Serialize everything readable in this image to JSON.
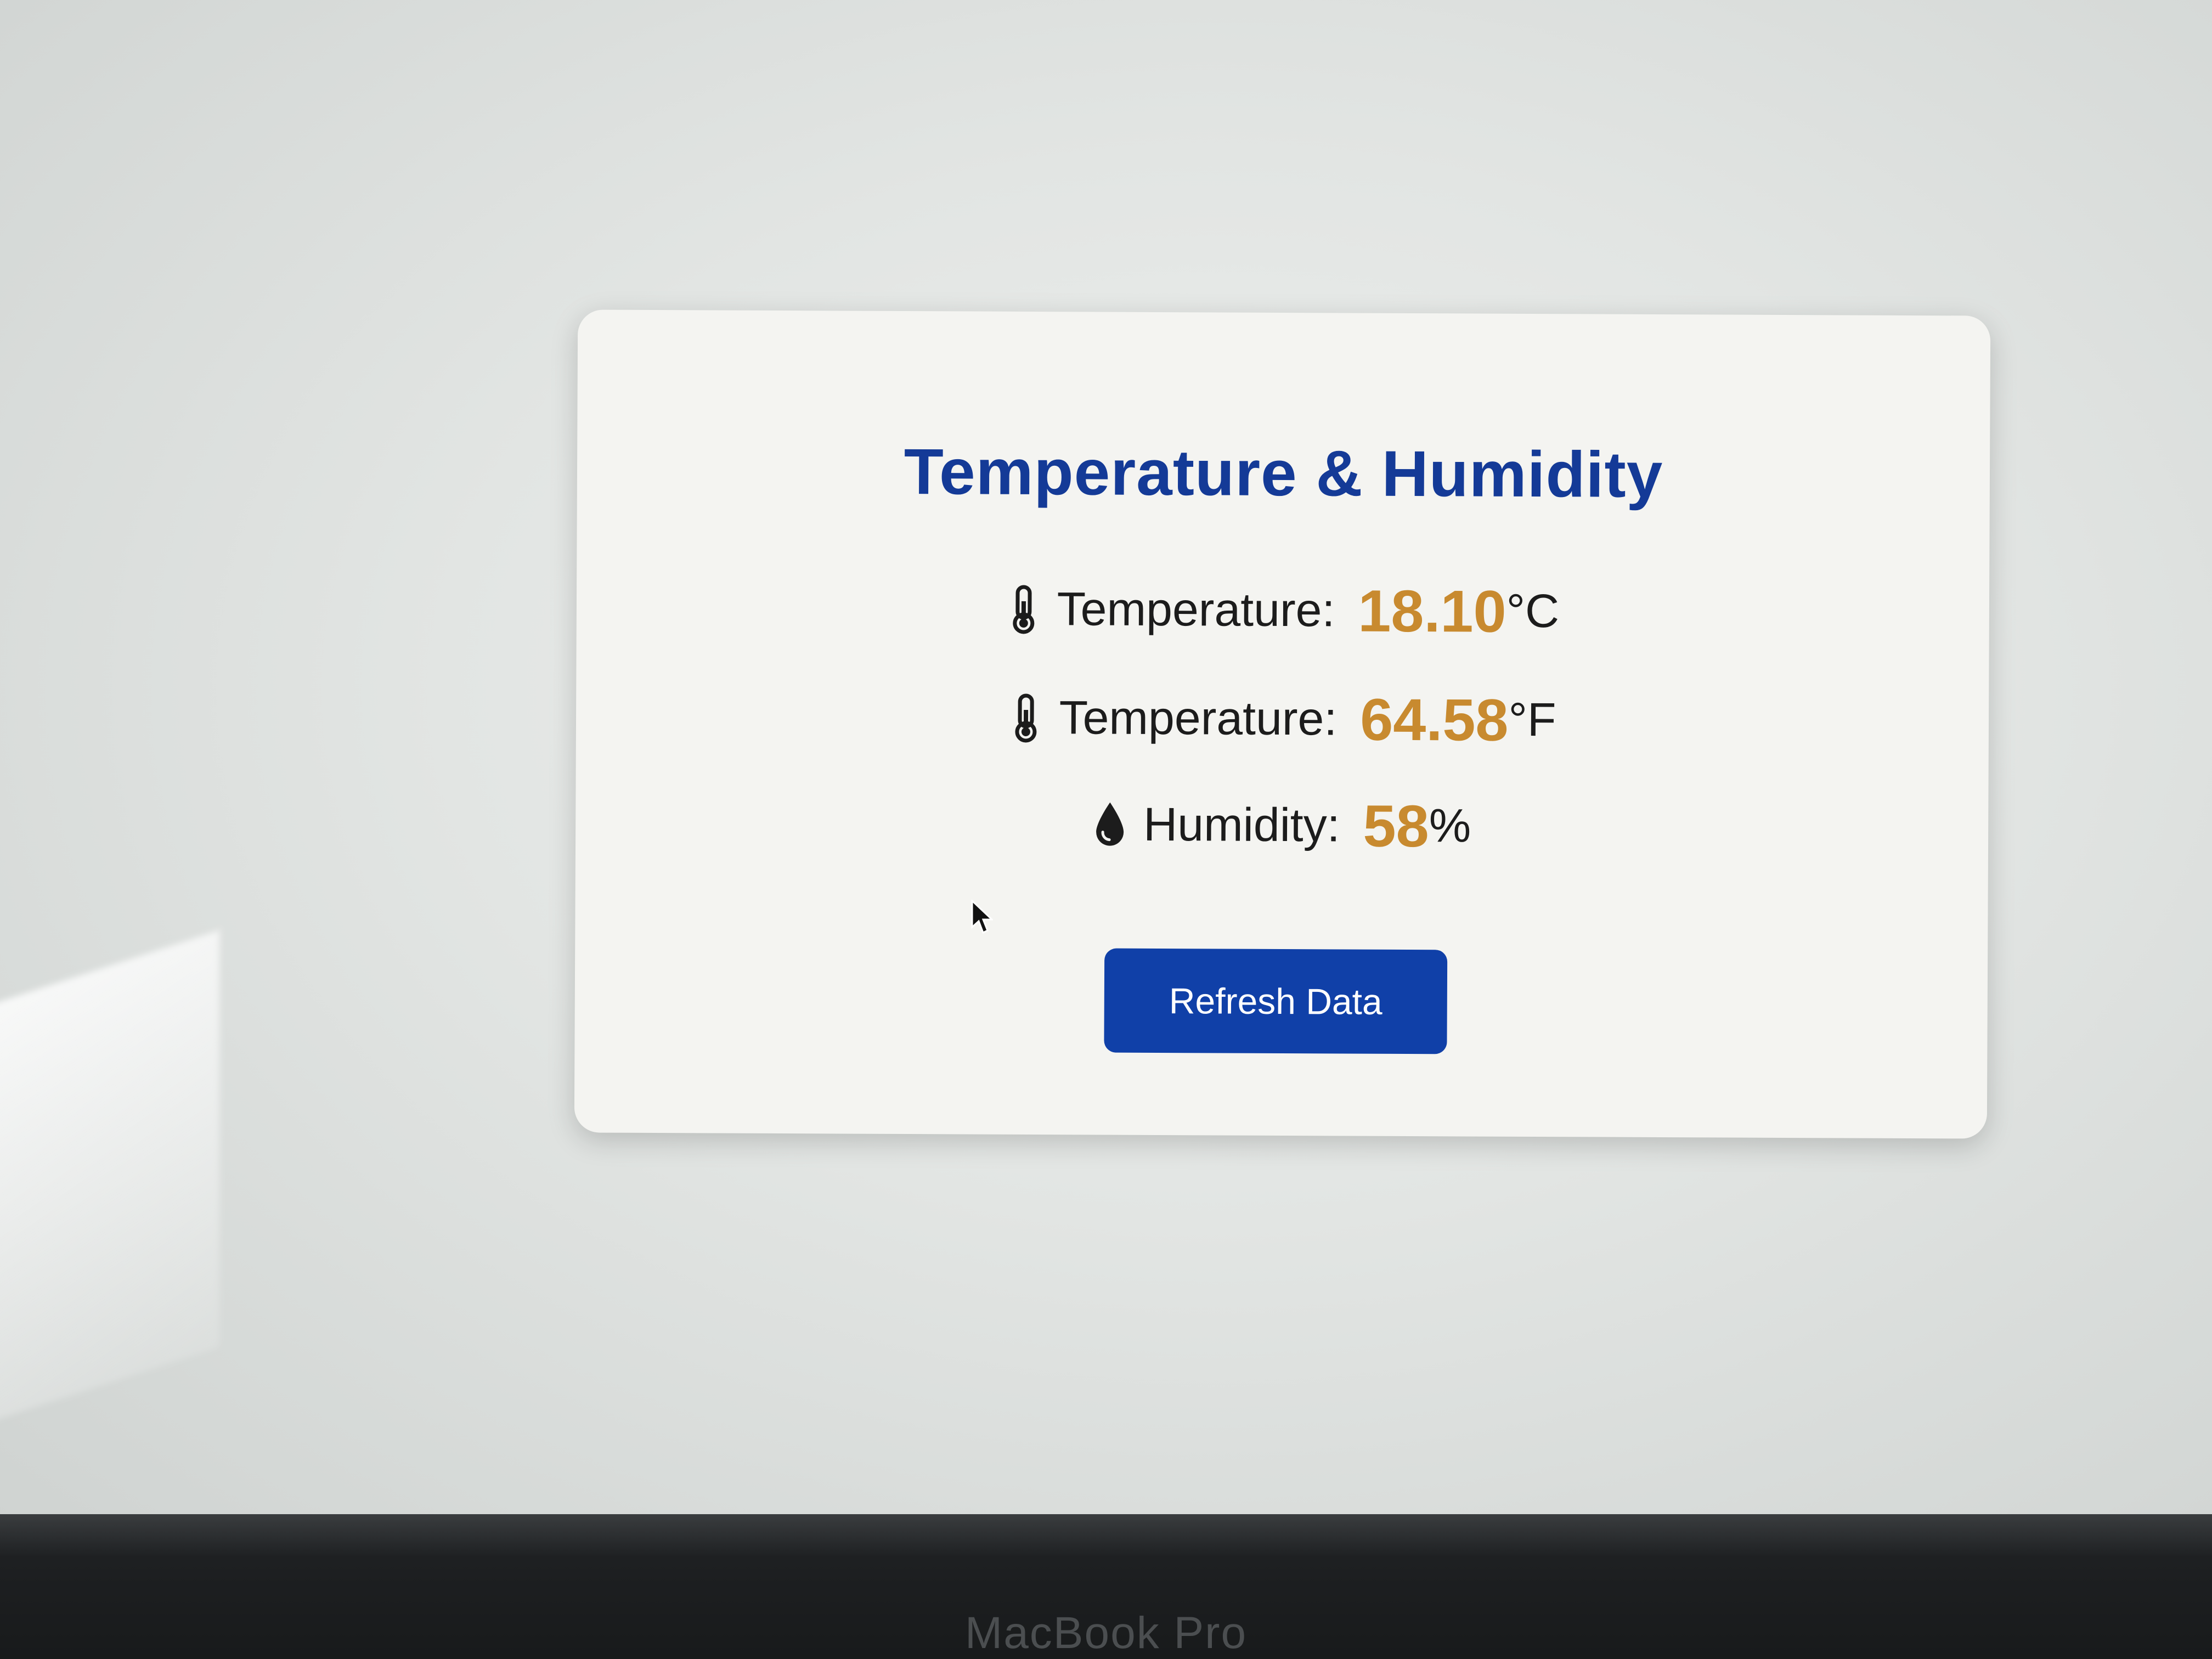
{
  "card": {
    "title": "Temperature & Humidity",
    "rows": [
      {
        "icon": "thermometer-icon",
        "label": "Temperature:",
        "value": "18.10",
        "unit": "°C"
      },
      {
        "icon": "thermometer-icon",
        "label": "Temperature:",
        "value": "64.58",
        "unit": "°F"
      },
      {
        "icon": "water-drop-icon",
        "label": "Humidity:",
        "value": "58",
        "unit": "%"
      }
    ],
    "refresh_label": "Refresh Data"
  },
  "device": {
    "brand_label": "MacBook Pro"
  },
  "colors": {
    "title": "#143a97",
    "value": "#c88a2f",
    "button": "#1040a8",
    "card_background": "#f4f4f1"
  }
}
